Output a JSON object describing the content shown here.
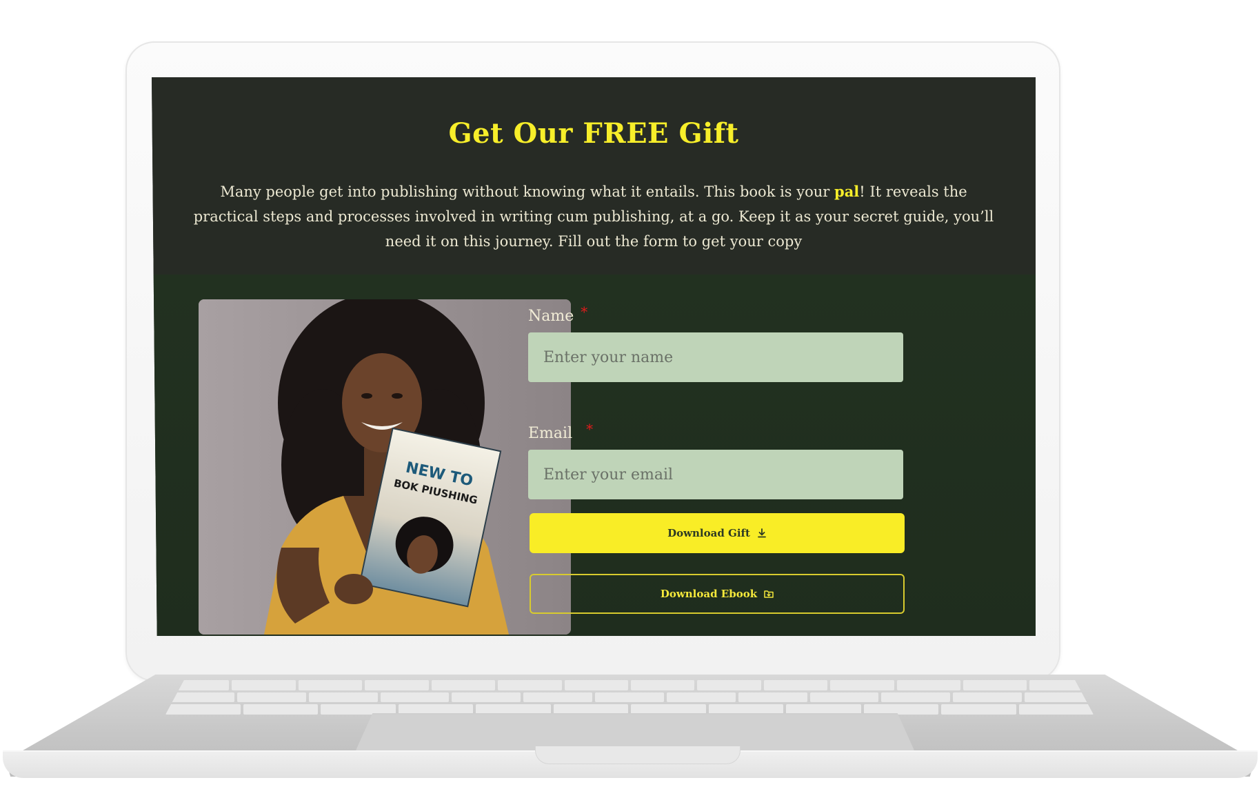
{
  "hero": {
    "title": "Get Our FREE Gift",
    "description_part1": "Many people get into publishing without knowing what it entails. This book is your ",
    "description_highlight": "pal",
    "description_part2": "! It reveals the practical steps and processes involved in writing cum publishing, at a go. Keep it as your secret guide, you’ll need it on this journey. Fill out the form to get your copy"
  },
  "form": {
    "name_label": "Name",
    "name_placeholder": "Enter your name",
    "email_label": "Email",
    "email_placeholder": "Enter your email",
    "required_mark": "*",
    "download_gift_label": "Download Gift",
    "download_ebook_label": "Download Ebook"
  },
  "book_cover": {
    "title_line1": "NEW TO",
    "title_line2": "BOK PIUSHING"
  },
  "colors": {
    "accent_yellow": "#f9ed26",
    "hero_bg": "#272b25",
    "form_bg": "#223120",
    "input_bg": "#bfd4b8",
    "required_red": "#e21b1b"
  },
  "icons": {
    "gift_button_icon": "download-icon",
    "ebook_button_icon": "folder-download-icon"
  }
}
